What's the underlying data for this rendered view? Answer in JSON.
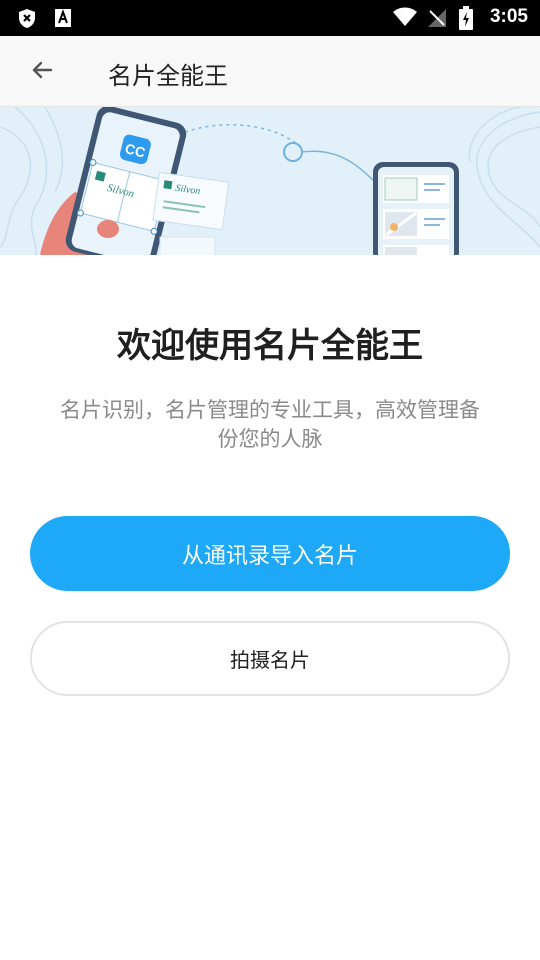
{
  "status_bar": {
    "time": "3:05",
    "icons": [
      "shield-x-icon",
      "text-a-icon",
      "wifi-icon",
      "no-signal-icon",
      "battery-charging-icon"
    ]
  },
  "app_bar": {
    "back_icon": "arrow-left-icon",
    "title": "名片全能王"
  },
  "banner": {
    "app_logo_text": "CC",
    "card_text": "Silvon"
  },
  "main": {
    "title": "欢迎使用名片全能王",
    "subtitle": "名片识别，名片管理的专业工具，高效管理备份您的人脉"
  },
  "buttons": {
    "import_contacts": "从通讯录导入名片",
    "take_photo": "拍摄名片"
  },
  "colors": {
    "primary": "#1da8f8",
    "banner_bg": "#e2f0fa",
    "status_bar": "#000000"
  }
}
